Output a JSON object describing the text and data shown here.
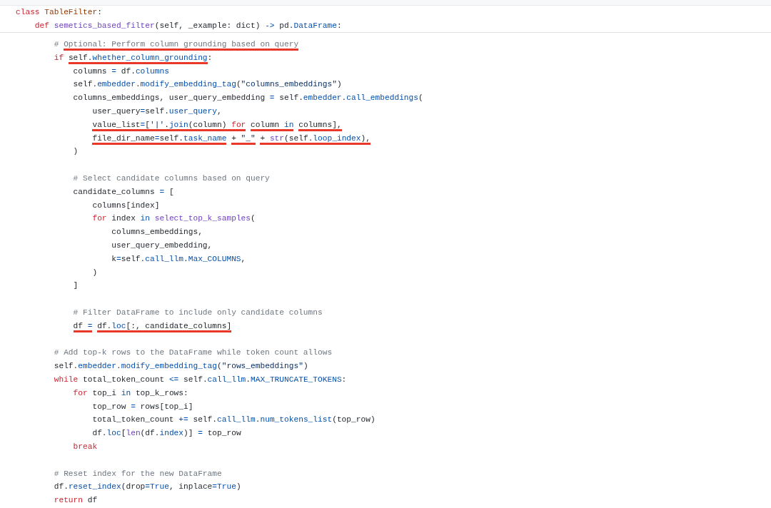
{
  "header_lines": [
    {
      "tokens": [
        {
          "kind": "keyword",
          "text": "class "
        },
        {
          "kind": "classname",
          "text": "TableFilter"
        },
        {
          "kind": "plain",
          "text": ":"
        }
      ]
    },
    {
      "tokens": [
        {
          "kind": "keyword",
          "text": "    def "
        },
        {
          "kind": "function",
          "text": "semetics_based_filter"
        },
        {
          "kind": "plain",
          "text": "(self, _example: dict) "
        },
        {
          "kind": "attr",
          "text": "->"
        },
        {
          "kind": "plain",
          "text": " pd."
        },
        {
          "kind": "attr",
          "text": "DataFrame"
        },
        {
          "kind": "plain",
          "text": ":"
        }
      ]
    }
  ],
  "blocks": [
    [
      {
        "tokens": [
          {
            "kind": "comment",
            "text": "        # ",
            "marked": false
          },
          {
            "kind": "comment",
            "text": "Optional: Perform column grounding based on query",
            "marked": true
          }
        ]
      },
      {
        "tokens": [
          {
            "kind": "keyword",
            "text": "        if",
            "marked": false
          },
          {
            "kind": "plain",
            "text": " self.",
            "marked": true
          },
          {
            "kind": "attr",
            "text": "whether_column_grounding",
            "marked": true
          },
          {
            "kind": "plain",
            "text": ":",
            "marked": false
          }
        ]
      },
      {
        "tokens": [
          {
            "kind": "plain",
            "text": "            columns "
          },
          {
            "kind": "attr",
            "text": "="
          },
          {
            "kind": "plain",
            "text": " df."
          },
          {
            "kind": "attr",
            "text": "columns"
          }
        ]
      },
      {
        "tokens": [
          {
            "kind": "plain",
            "text": "            self."
          },
          {
            "kind": "attr",
            "text": "embedder"
          },
          {
            "kind": "plain",
            "text": "."
          },
          {
            "kind": "attr",
            "text": "modify_embedding_tag"
          },
          {
            "kind": "plain",
            "text": "("
          },
          {
            "kind": "string",
            "text": "\"columns_embeddings\""
          },
          {
            "kind": "plain",
            "text": ")"
          }
        ]
      },
      {
        "tokens": [
          {
            "kind": "plain",
            "text": "            columns_embeddings, user_query_embedding "
          },
          {
            "kind": "attr",
            "text": "="
          },
          {
            "kind": "plain",
            "text": " self."
          },
          {
            "kind": "attr",
            "text": "embedder"
          },
          {
            "kind": "plain",
            "text": "."
          },
          {
            "kind": "attr",
            "text": "call_embeddings"
          },
          {
            "kind": "plain",
            "text": "("
          }
        ]
      },
      {
        "tokens": [
          {
            "kind": "plain",
            "text": "                user_query"
          },
          {
            "kind": "attr",
            "text": "="
          },
          {
            "kind": "plain",
            "text": "self."
          },
          {
            "kind": "attr",
            "text": "user_query"
          },
          {
            "kind": "plain",
            "text": ","
          }
        ]
      },
      {
        "tokens": [
          {
            "kind": "plain",
            "text": "                value_list",
            "marked": true
          },
          {
            "kind": "attr",
            "text": "=",
            "marked": true
          },
          {
            "kind": "plain",
            "text": "[",
            "marked": true
          },
          {
            "kind": "string",
            "text": "'|'",
            "marked": true
          },
          {
            "kind": "plain",
            "text": ".",
            "marked": true
          },
          {
            "kind": "attr",
            "text": "join",
            "marked": true
          },
          {
            "kind": "plain",
            "text": "(column) ",
            "marked": true
          },
          {
            "kind": "keyword",
            "text": "for",
            "marked": true
          },
          {
            "kind": "plain",
            "text": " column ",
            "marked": true
          },
          {
            "kind": "attr",
            "text": "in",
            "marked": true
          },
          {
            "kind": "plain",
            "text": " columns],",
            "marked": true
          }
        ]
      },
      {
        "tokens": [
          {
            "kind": "plain",
            "text": "                file_dir_name",
            "marked": true
          },
          {
            "kind": "attr",
            "text": "=",
            "marked": true
          },
          {
            "kind": "plain",
            "text": "self.",
            "marked": true
          },
          {
            "kind": "attr",
            "text": "task_name",
            "marked": true
          },
          {
            "kind": "plain",
            "text": " + ",
            "marked": true
          },
          {
            "kind": "string",
            "text": "\"_\"",
            "marked": true
          },
          {
            "kind": "plain",
            "text": " + ",
            "marked": true
          },
          {
            "kind": "function",
            "text": "str",
            "marked": true
          },
          {
            "kind": "plain",
            "text": "(self.",
            "marked": true
          },
          {
            "kind": "attr",
            "text": "loop_index",
            "marked": true
          },
          {
            "kind": "plain",
            "text": "),",
            "marked": true
          }
        ]
      },
      {
        "tokens": [
          {
            "kind": "plain",
            "text": "            )"
          }
        ]
      }
    ],
    [
      {
        "tokens": [
          {
            "kind": "comment",
            "text": "            # Select candidate columns based on query"
          }
        ]
      },
      {
        "tokens": [
          {
            "kind": "plain",
            "text": "            candidate_columns "
          },
          {
            "kind": "attr",
            "text": "="
          },
          {
            "kind": "plain",
            "text": " ["
          }
        ]
      },
      {
        "tokens": [
          {
            "kind": "plain",
            "text": "                columns[index]"
          }
        ]
      },
      {
        "tokens": [
          {
            "kind": "keyword",
            "text": "                for"
          },
          {
            "kind": "plain",
            "text": " index "
          },
          {
            "kind": "attr",
            "text": "in "
          },
          {
            "kind": "function",
            "text": "select_top_k_samples"
          },
          {
            "kind": "plain",
            "text": "("
          }
        ]
      },
      {
        "tokens": [
          {
            "kind": "plain",
            "text": "                    columns_embeddings,"
          }
        ]
      },
      {
        "tokens": [
          {
            "kind": "plain",
            "text": "                    user_query_embedding,"
          }
        ]
      },
      {
        "tokens": [
          {
            "kind": "plain",
            "text": "                    k"
          },
          {
            "kind": "attr",
            "text": "="
          },
          {
            "kind": "plain",
            "text": "self."
          },
          {
            "kind": "attr",
            "text": "call_llm"
          },
          {
            "kind": "plain",
            "text": "."
          },
          {
            "kind": "attr",
            "text": "Max_COLUMNS"
          },
          {
            "kind": "plain",
            "text": ","
          }
        ]
      },
      {
        "tokens": [
          {
            "kind": "plain",
            "text": "                )"
          }
        ]
      },
      {
        "tokens": [
          {
            "kind": "plain",
            "text": "            ]"
          }
        ]
      }
    ],
    [
      {
        "tokens": [
          {
            "kind": "comment",
            "text": "            # Filter DataFrame to include only candidate columns"
          }
        ]
      },
      {
        "tokens": [
          {
            "kind": "plain",
            "text": "            df ",
            "marked": true
          },
          {
            "kind": "attr",
            "text": "=",
            "marked": true
          },
          {
            "kind": "plain",
            "text": " df.",
            "marked": true
          },
          {
            "kind": "attr",
            "text": "loc",
            "marked": true
          },
          {
            "kind": "plain",
            "text": "[:, candidate_columns]",
            "marked": true
          }
        ]
      }
    ],
    [
      {
        "tokens": [
          {
            "kind": "comment",
            "text": "        # Add top-k rows to the DataFrame while token count allows"
          }
        ]
      },
      {
        "tokens": [
          {
            "kind": "plain",
            "text": "        self."
          },
          {
            "kind": "attr",
            "text": "embedder"
          },
          {
            "kind": "plain",
            "text": "."
          },
          {
            "kind": "attr",
            "text": "modify_embedding_tag"
          },
          {
            "kind": "plain",
            "text": "("
          },
          {
            "kind": "string",
            "text": "\"rows_embeddings\""
          },
          {
            "kind": "plain",
            "text": ")"
          }
        ]
      },
      {
        "tokens": [
          {
            "kind": "keyword",
            "text": "        while"
          },
          {
            "kind": "plain",
            "text": " total_token_count "
          },
          {
            "kind": "attr",
            "text": "<="
          },
          {
            "kind": "plain",
            "text": " self."
          },
          {
            "kind": "attr",
            "text": "call_llm"
          },
          {
            "kind": "plain",
            "text": "."
          },
          {
            "kind": "attr",
            "text": "MAX_TRUNCATE_TOKENS"
          },
          {
            "kind": "plain",
            "text": ":"
          }
        ]
      },
      {
        "tokens": [
          {
            "kind": "keyword",
            "text": "            for"
          },
          {
            "kind": "plain",
            "text": " top_i "
          },
          {
            "kind": "attr",
            "text": "in"
          },
          {
            "kind": "plain",
            "text": " top_k_rows:"
          }
        ]
      },
      {
        "tokens": [
          {
            "kind": "plain",
            "text": "                top_row "
          },
          {
            "kind": "attr",
            "text": "="
          },
          {
            "kind": "plain",
            "text": " rows[top_i]"
          }
        ]
      },
      {
        "tokens": [
          {
            "kind": "plain",
            "text": "                total_token_count "
          },
          {
            "kind": "attr",
            "text": "+="
          },
          {
            "kind": "plain",
            "text": " self."
          },
          {
            "kind": "attr",
            "text": "call_llm"
          },
          {
            "kind": "plain",
            "text": "."
          },
          {
            "kind": "attr",
            "text": "num_tokens_list"
          },
          {
            "kind": "plain",
            "text": "(top_row)"
          }
        ]
      },
      {
        "tokens": [
          {
            "kind": "plain",
            "text": "                df."
          },
          {
            "kind": "attr",
            "text": "loc"
          },
          {
            "kind": "plain",
            "text": "["
          },
          {
            "kind": "function",
            "text": "len"
          },
          {
            "kind": "plain",
            "text": "(df."
          },
          {
            "kind": "attr",
            "text": "index"
          },
          {
            "kind": "plain",
            "text": ")] "
          },
          {
            "kind": "attr",
            "text": "="
          },
          {
            "kind": "plain",
            "text": " top_row"
          }
        ]
      },
      {
        "tokens": [
          {
            "kind": "keyword",
            "text": "            break"
          }
        ]
      }
    ],
    [
      {
        "tokens": [
          {
            "kind": "comment",
            "text": "        # Reset index for the new DataFrame"
          }
        ]
      },
      {
        "tokens": [
          {
            "kind": "plain",
            "text": "        df."
          },
          {
            "kind": "attr",
            "text": "reset_index"
          },
          {
            "kind": "plain",
            "text": "(drop"
          },
          {
            "kind": "attr",
            "text": "="
          },
          {
            "kind": "attr",
            "text": "True"
          },
          {
            "kind": "plain",
            "text": ", inplace"
          },
          {
            "kind": "attr",
            "text": "="
          },
          {
            "kind": "attr",
            "text": "True"
          },
          {
            "kind": "plain",
            "text": ")"
          }
        ]
      },
      {
        "tokens": [
          {
            "kind": "keyword",
            "text": "        return"
          },
          {
            "kind": "plain",
            "text": " df"
          }
        ]
      }
    ]
  ]
}
